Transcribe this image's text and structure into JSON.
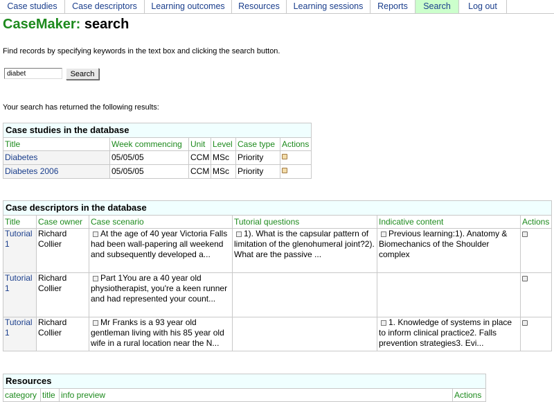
{
  "nav": {
    "tabs": [
      {
        "label": "Case studies"
      },
      {
        "label": "Case descriptors"
      },
      {
        "label": "Learning outcomes"
      },
      {
        "label": "Resources"
      },
      {
        "label": "Learning sessions"
      },
      {
        "label": "Reports"
      },
      {
        "label": "Search",
        "active": true
      },
      {
        "label": "Log out"
      }
    ]
  },
  "page": {
    "brand": "CaseMaker:",
    "title": "search",
    "intro": "Find records by specifying keywords in the text box and clicking the search button.",
    "results_text": "Your search has returned the following results:"
  },
  "search": {
    "value": "diabet",
    "button_label": "Search"
  },
  "case_studies": {
    "caption": "Case studies in the database",
    "headers": [
      "Title",
      "Week commencing",
      "Unit",
      "Level",
      "Case type",
      "Actions"
    ],
    "rows": [
      {
        "title": "Diabetes",
        "week": "05/05/05",
        "unit": "CCM",
        "level": "MSc",
        "type": "Priority"
      },
      {
        "title": "Diabetes 2006",
        "week": "05/05/05",
        "unit": "CCM",
        "level": "MSc",
        "type": "Priority"
      }
    ]
  },
  "case_descriptors": {
    "caption": "Case descriptors in the database",
    "headers": [
      "Title",
      "Case owner",
      "Case scenario",
      "Tutorial questions",
      "Indicative content",
      "Actions"
    ],
    "rows": [
      {
        "title": "Tutorial 1",
        "owner": "Richard Collier",
        "scenario": "At the age of 40 year Victoria Falls had been wall-papering all weekend and subsequently developed a...",
        "questions": "1). What is the capsular pattern of limitation of the glenohumeral joint?2). What are the passive ...",
        "content": "Previous learning:1). Anatomy & Biomechanics of the Shoulder complex"
      },
      {
        "title": "Tutorial 1",
        "owner": "Richard Collier",
        "scenario": "Part 1You are a 40 year old physiotherapist, you're a keen runner and had represented your count...",
        "questions": "",
        "content": ""
      },
      {
        "title": "Tutorial 1",
        "owner": "Richard Collier",
        "scenario": "Mr Franks is a 93 year old gentleman living with his 85 year old wife in a rural location near the N...",
        "questions": "",
        "content": "1. Knowledge of systems in place to inform clinical practice2. Falls prevention strategies3. Evi..."
      }
    ]
  },
  "resources": {
    "caption": "Resources",
    "headers": [
      "category",
      "title",
      "info preview",
      "Actions"
    ]
  },
  "icons": {
    "doc": "document-icon",
    "edit": "edit-icon"
  },
  "colors": {
    "brand": "#1d8a1d",
    "link": "#1a3e8c",
    "active_tab": "#ccffcc",
    "caption_bg": "#f0ffff"
  }
}
